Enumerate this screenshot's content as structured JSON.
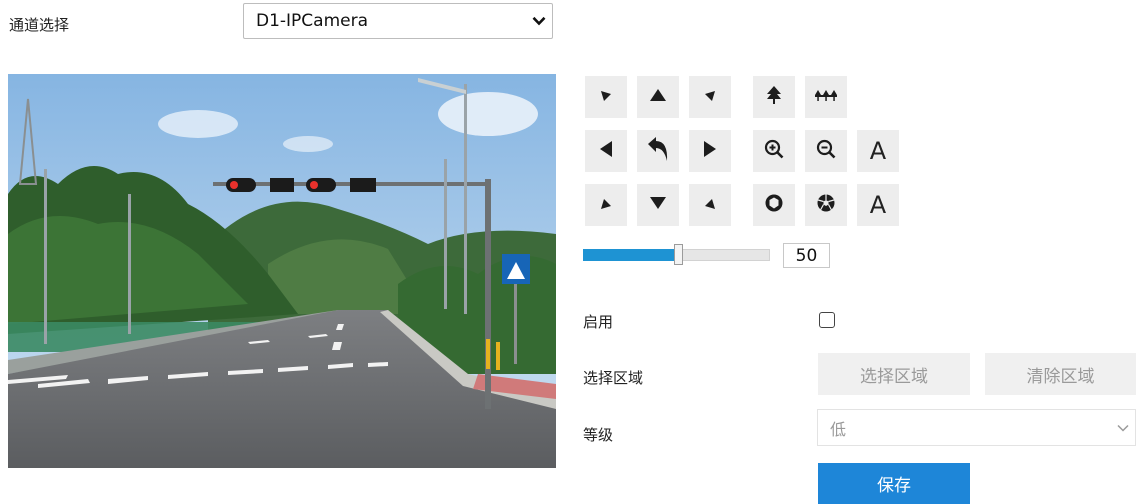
{
  "channel": {
    "label": "通道选择",
    "selected": "D1-IPCamera"
  },
  "ptz": {
    "buttons": [
      {
        "name": "ptz-up-left",
        "icon": "up-left-arrow-icon"
      },
      {
        "name": "ptz-up",
        "icon": "up-arrow-icon"
      },
      {
        "name": "ptz-up-right",
        "icon": "up-right-arrow-icon"
      },
      {
        "name": "ptz-left",
        "icon": "left-arrow-icon"
      },
      {
        "name": "ptz-home",
        "icon": "return-arrow-icon"
      },
      {
        "name": "ptz-right",
        "icon": "right-arrow-icon"
      },
      {
        "name": "ptz-down-left",
        "icon": "down-left-arrow-icon"
      },
      {
        "name": "ptz-down",
        "icon": "down-arrow-icon"
      },
      {
        "name": "ptz-down-right",
        "icon": "down-right-arrow-icon"
      },
      {
        "name": "focus-near",
        "icon": "tree-icon"
      },
      {
        "name": "focus-far",
        "icon": "forest-icon"
      },
      {
        "name": "zoom-in",
        "icon": "zoom-in-icon"
      },
      {
        "name": "zoom-out",
        "icon": "zoom-out-icon"
      },
      {
        "name": "iris-open",
        "icon": "iris-open-icon"
      },
      {
        "name": "iris-close",
        "icon": "iris-close-icon"
      }
    ],
    "auto_focus_label": "A",
    "auto_iris_label": "A",
    "speed_value": "50",
    "speed_fraction": 0.5
  },
  "form": {
    "enable_label": "启用",
    "enable_checked": false,
    "region_label": "选择区域",
    "select_region_btn": "选择区域",
    "clear_region_btn": "清除区域",
    "level_label": "等级",
    "level_value": "低",
    "save_btn": "保存"
  },
  "colors": {
    "accent": "#1e86d8",
    "slider": "#1e93d3"
  }
}
